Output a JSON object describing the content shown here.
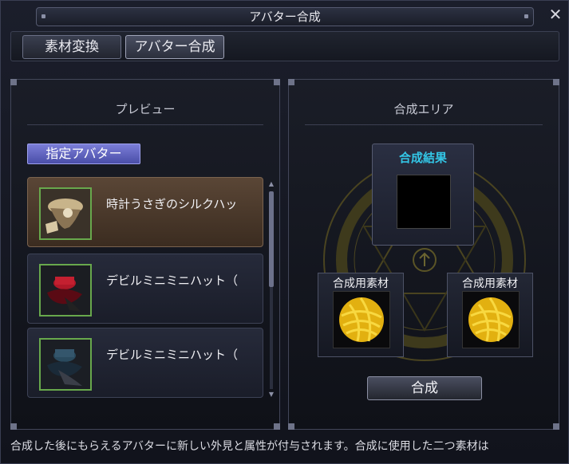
{
  "window": {
    "title": "アバター合成",
    "close_icon": "close-icon"
  },
  "tabs": [
    {
      "label": "素材変換",
      "active": false
    },
    {
      "label": "アバター合成",
      "active": true
    }
  ],
  "preview": {
    "header": "プレビュー",
    "badge": "指定アバター",
    "items": [
      {
        "label": "時計うさぎのシルクハッ",
        "selected": true,
        "icon": "silk-hat-icon"
      },
      {
        "label": "デビルミニミニハット（",
        "selected": false,
        "icon": "red-mini-hat-icon"
      },
      {
        "label": "デビルミニミニハット（",
        "selected": false,
        "icon": "navy-mini-hat-icon"
      }
    ]
  },
  "synthesis": {
    "header": "合成エリア",
    "result_title": "合成結果",
    "material_title_left": "合成用素材",
    "material_title_right": "合成用素材",
    "button": "合成"
  },
  "footer": "合成した後にもらえるアバターに新しい外見と属性が付与されます。合成に使用した二つ素材は",
  "colors": {
    "accent": "#33c6e6",
    "badge": "#6366c6",
    "selected_item": "#4a3828",
    "item_border": "#68a84c",
    "yarn": "#f0c018"
  }
}
